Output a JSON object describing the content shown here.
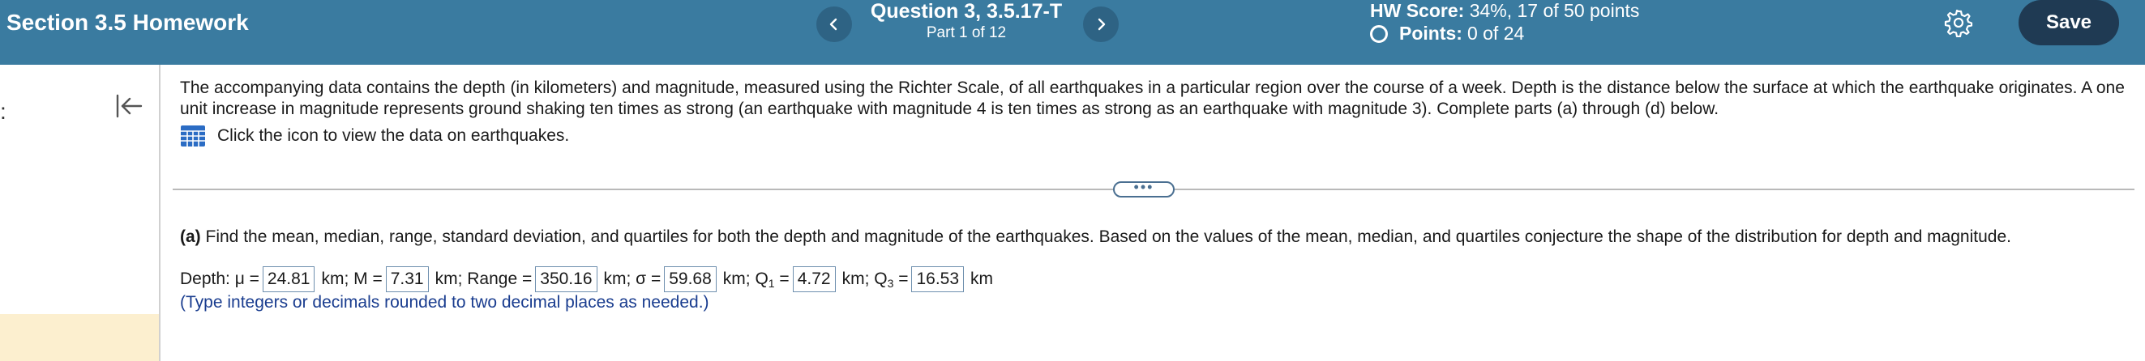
{
  "header": {
    "title": "Section 3.5 Homework",
    "question_title": "Question 3, 3.5.17-T",
    "question_part": "Part 1 of 12",
    "hw_score_label": "HW Score:",
    "hw_score_value": "34%, 17 of 50 points",
    "points_label": "Points:",
    "points_value": "0 of 24",
    "save_label": "Save"
  },
  "left_rail": {
    "mark": ":"
  },
  "content": {
    "intro_text": "The accompanying data contains the depth (in kilometers) and magnitude, measured using the Richter Scale, of all earthquakes in a particular region over the course of a week. Depth is the distance below the surface at which the earthquake originates. A one unit increase in magnitude represents ground shaking ten times as strong (an earthquake with magnitude 4 is ten times as strong as an earthquake with magnitude 3). Complete parts (a) through (d) below.",
    "data_link_text": "Click the icon to view the data on earthquakes.",
    "expander_label": "•••"
  },
  "part_a": {
    "label": "(a)",
    "question": " Find the mean, median, range, standard deviation, and quartiles for both the depth and magnitude of the earthquakes. Based on the values of the mean, median, and quartiles conjecture the shape of the distribution for depth and magnitude.",
    "depth_prefix": "Depth: μ =",
    "mean_value": "24.81",
    "median_prefix": "km; M =",
    "median_value": "7.31",
    "range_prefix": "km; Range =",
    "range_value": "350.16",
    "sd_prefix": "km; σ =",
    "sd_value": "59.68",
    "q1_prefix_a": "km; Q",
    "q1_sub": "1",
    "q1_prefix_b": " =",
    "q1_value": "4.72",
    "q3_prefix_a": "km; Q",
    "q3_sub": "3",
    "q3_prefix_b": " =",
    "q3_value": "16.53",
    "suffix": "km",
    "hint": "(Type integers or decimals rounded to two decimal places as needed.)"
  },
  "colors": {
    "header_bg": "#3a7ba0",
    "save_bg": "#1f3a53",
    "hint_text": "#1a3d8f",
    "rail_highlight": "#fcefcf"
  },
  "icons": [
    "chevron-left-icon",
    "chevron-right-icon",
    "gear-icon",
    "collapse-left-icon",
    "data-table-icon",
    "radio-circle-icon"
  ]
}
